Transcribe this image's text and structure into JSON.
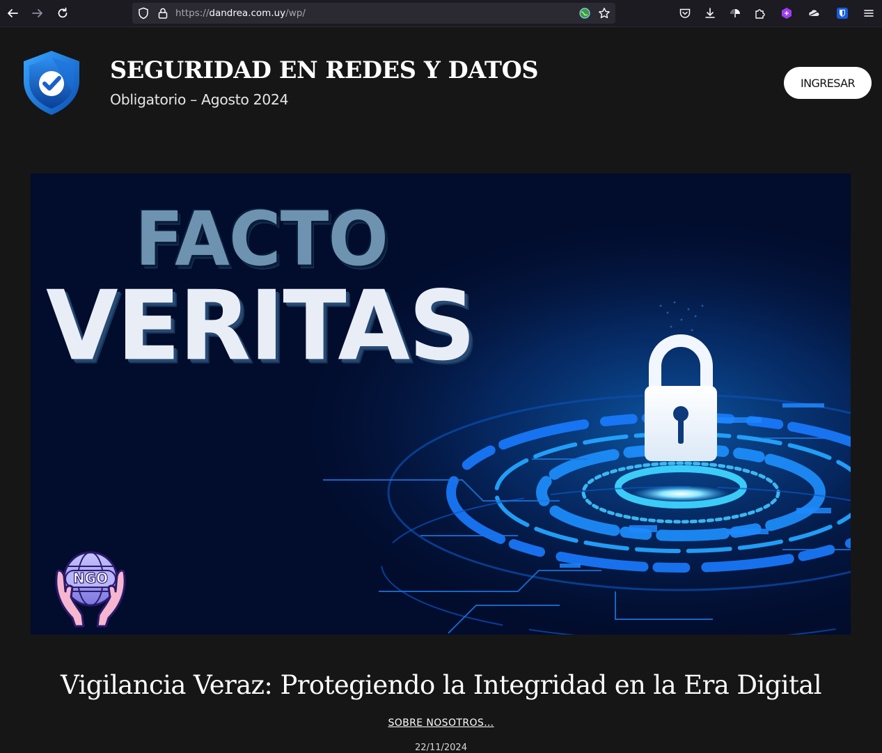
{
  "browser": {
    "url": {
      "prefix": "https://",
      "domain": "dandrea.com.uy",
      "path": "/wp/"
    },
    "icons": {
      "back": "arrow-left-icon",
      "forward": "arrow-right-icon",
      "reload": "reload-icon",
      "tracking_protection": "shield-icon",
      "lock": "lock-icon",
      "site_extension": "globe-icon",
      "bookmark": "star-icon",
      "pocket": "pocket-icon",
      "downloads": "download-icon",
      "extensions": [
        "umbrella-icon",
        "puzzle-icon",
        "hexagon-extension-icon",
        "cloud-extension-icon",
        "bitwarden-icon"
      ],
      "menu": "hamburger-menu-icon"
    }
  },
  "header": {
    "title": "SEGURIDAD EN REDES Y DATOS",
    "tagline": "Obligatorio – Agosto 2024",
    "login_label": "INGRESAR",
    "logo": "shield-check-logo"
  },
  "hero": {
    "title_top": "FACTO",
    "title_main": "VERITAS",
    "badge_text": "NGO",
    "image": "padlock-cyber-illustration"
  },
  "post": {
    "title": "Vigilancia Veraz: Protegiendo la Integridad en la Era Digital",
    "link": "SOBRE NOSOTROS…",
    "date": "22/11/2024"
  },
  "colors": {
    "page_bg": "#161616",
    "toolbar_bg": "#1c1b22",
    "hero_bg": "#020c2c",
    "accent_blue": "#1f8bff",
    "button_bg": "#ffffff"
  }
}
